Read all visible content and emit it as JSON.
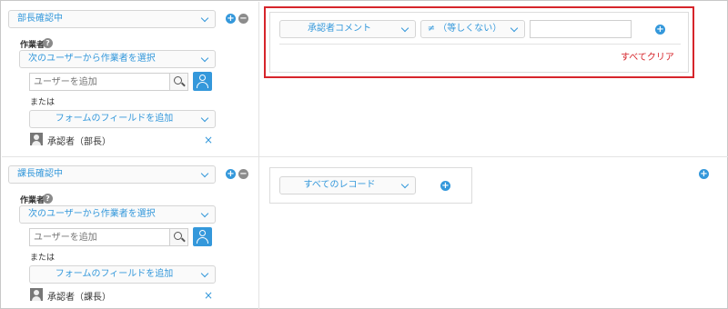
{
  "steps": [
    {
      "status_label": "部長確認中",
      "assignee_label": "作業者",
      "help_icon_glyph": "?",
      "assignee_type": "次のユーザーから作業者を選択",
      "search_placeholder": "ユーザーを追加",
      "or_label": "または",
      "field_add_label": "フォームのフィールドを追加",
      "assigned_entity": "承認者（部長）",
      "remove_glyph": "×",
      "condition": {
        "field": "承認者コメント",
        "operator": "≠ （等しくない）",
        "value": "",
        "clear_all": "すべてクリア"
      }
    },
    {
      "status_label": "課長確認中",
      "assignee_label": "作業者",
      "help_icon_glyph": "?",
      "assignee_type": "次のユーザーから作業者を選択",
      "search_placeholder": "ユーザーを追加",
      "or_label": "または",
      "field_add_label": "フォームのフィールドを追加",
      "assigned_entity": "承認者（課長）",
      "remove_glyph": "×",
      "condition": {
        "field": "すべてのレコード"
      }
    }
  ],
  "icons": {
    "plus": "+",
    "minus": "−"
  },
  "colors": {
    "accent": "#3498db",
    "highlight": "#d6252b",
    "minus": "#8c8c8c"
  }
}
